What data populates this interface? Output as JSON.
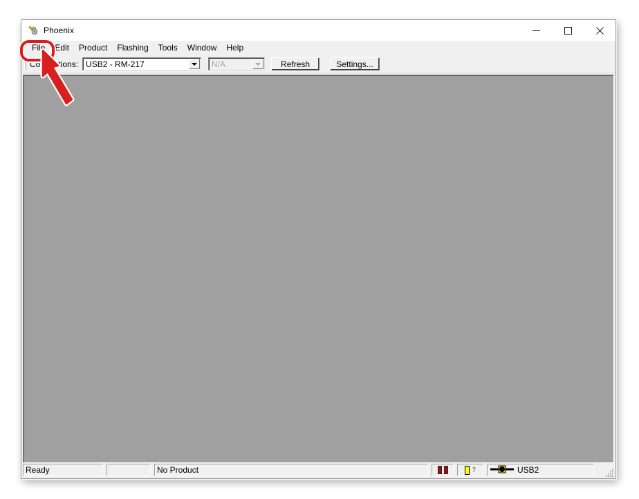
{
  "window": {
    "title": "Phoenix",
    "app_icon": "phoenix-app-icon",
    "caption": {
      "minimize_label": "Minimize",
      "maximize_label": "Maximize",
      "close_label": "Close"
    }
  },
  "menubar": {
    "items": [
      {
        "label": "File",
        "name": "menu-file"
      },
      {
        "label": "Edit",
        "name": "menu-edit"
      },
      {
        "label": "Product",
        "name": "menu-product"
      },
      {
        "label": "Flashing",
        "name": "menu-flashing"
      },
      {
        "label": "Tools",
        "name": "menu-tools"
      },
      {
        "label": "Window",
        "name": "menu-window"
      },
      {
        "label": "Help",
        "name": "menu-help"
      }
    ]
  },
  "toolbar": {
    "connections_label": "Connections:",
    "connection_value": "USB2 - RM-217",
    "connection_options": [
      "USB2 - RM-217"
    ],
    "secondary_value": "N/A",
    "secondary_disabled": true,
    "refresh_label": "Refresh",
    "settings_label": "Settings..."
  },
  "statusbar": {
    "status_text": "Ready",
    "empty_panel": "",
    "product_text": "No Product",
    "progress_icon": "red-bars-icon",
    "unknown_icon": "yellow-bar-question-icon",
    "connection_icon": "usb-cable-icon",
    "connection_text": "USB2",
    "resize_grip": "resize-grip-icon"
  },
  "annotation": {
    "highlight_target": "File",
    "highlight_color": "#e01b1b",
    "arrow_color": "#d81f1f",
    "arrow_outline": "#ffffff"
  }
}
